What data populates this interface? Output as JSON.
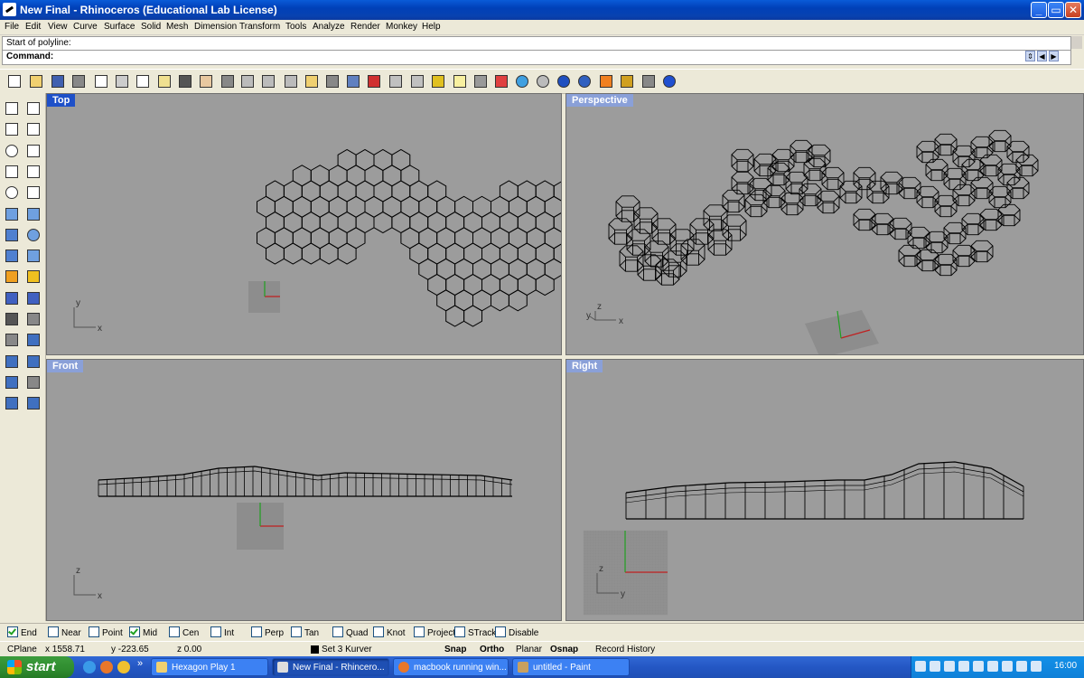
{
  "window": {
    "title": "New Final - Rhinoceros (Educational Lab License)",
    "controls": {
      "minimize": "_",
      "restore": "▭",
      "close": "✕"
    }
  },
  "menu": [
    "File",
    "Edit",
    "View",
    "Curve",
    "Surface",
    "Solid",
    "Mesh",
    "Dimension",
    "Transform",
    "Tools",
    "Analyze",
    "Render",
    "Monkey",
    "Help"
  ],
  "command": {
    "history": "Start of polyline:",
    "prompt": "Command:"
  },
  "toolbar_icons": [
    "new-file-icon",
    "open-file-icon",
    "save-icon",
    "print-icon",
    "import-icon",
    "cut-icon",
    "copy-icon",
    "paste-icon",
    "undo-icon",
    "pan-hand-icon",
    "rotate-view-icon",
    "zoom-dynamic-icon",
    "zoom-window-icon",
    "zoom-extents-icon",
    "zoom-selected-icon",
    "undo-view-icon",
    "four-viewports-icon",
    "car-render-icon",
    "texture-icon",
    "cplane-icon",
    "snap-grid-icon",
    "light-bulb-icon",
    "lock-icon",
    "layer-icon",
    "color-wheel-icon",
    "wireframe-sphere-icon",
    "render-globe-icon",
    "shaded-sphere-icon",
    "highlight-icon",
    "options-gear-icon",
    "grid-options-icon",
    "help-icon"
  ],
  "left_toolbar_icons": [
    "select-arrow-icon",
    "point-icon",
    "polyline-icon",
    "curve-icon",
    "circle-icon",
    "arc-icon",
    "polygon-icon",
    "rectangle-icon",
    "ellipse-icon",
    "fillet-icon",
    "surface-patch-icon",
    "surface-edit-icon",
    "box-solid-icon",
    "sphere-solid-icon",
    "cylinder-icon",
    "mesh-icon",
    "boolean-icon",
    "explode-icon",
    "trim-icon",
    "split-icon",
    "group-icon",
    "join-icon",
    "dimension-icon",
    "text-icon",
    "block-icon",
    "transform-icon",
    "grid-array-icon",
    "scale-icon",
    "solid-tools-icon",
    "analyze-icon"
  ],
  "viewports": {
    "top": {
      "label": "Top",
      "axis_x": "x",
      "axis_y": "y"
    },
    "perspective": {
      "label": "Perspective",
      "axis_x": "x",
      "axis_y": "y",
      "axis_z": "z"
    },
    "front": {
      "label": "Front",
      "axis_x": "x",
      "axis_y": "z"
    },
    "right": {
      "label": "Right",
      "axis_x": "y",
      "axis_y": "z"
    }
  },
  "osnap": [
    {
      "label": "End",
      "checked": true
    },
    {
      "label": "Near",
      "checked": false
    },
    {
      "label": "Point",
      "checked": false
    },
    {
      "label": "Mid",
      "checked": true
    },
    {
      "label": "Cen",
      "checked": false
    },
    {
      "label": "Int",
      "checked": false
    },
    {
      "label": "Perp",
      "checked": false
    },
    {
      "label": "Tan",
      "checked": false
    },
    {
      "label": "Quad",
      "checked": false
    },
    {
      "label": "Knot",
      "checked": false
    },
    {
      "label": "Project",
      "checked": false
    },
    {
      "label": "STrack",
      "checked": false
    },
    {
      "label": "Disable",
      "checked": false
    }
  ],
  "status": {
    "cplane": "CPlane",
    "x": "x 1558.71",
    "y": "y -223.65",
    "z": "z 0.00",
    "layer": "Set 3 Kurver",
    "snap": "Snap",
    "ortho": "Ortho",
    "planar": "Planar",
    "osnap": "Osnap",
    "record_history": "Record History"
  },
  "taskbar": {
    "start": "start",
    "quicklaunch": [
      "ie-icon",
      "firefox-icon",
      "media-icon"
    ],
    "more": "»",
    "tasks": [
      {
        "label": "Hexagon Play 1",
        "active": false
      },
      {
        "label": "New Final - Rhincero...",
        "active": true
      },
      {
        "label": "macbook running win...",
        "active": false
      },
      {
        "label": "untitled - Paint",
        "active": false
      }
    ],
    "clock": "16:00"
  },
  "colors": {
    "title_blue": "#0a5bd8",
    "viewport_bg": "#9c9c9c",
    "active_tab": "#1e50c8",
    "inactive_tab": "#8aa0d8",
    "taskbar": "#2457c4",
    "start_green": "#3c9c3c"
  }
}
